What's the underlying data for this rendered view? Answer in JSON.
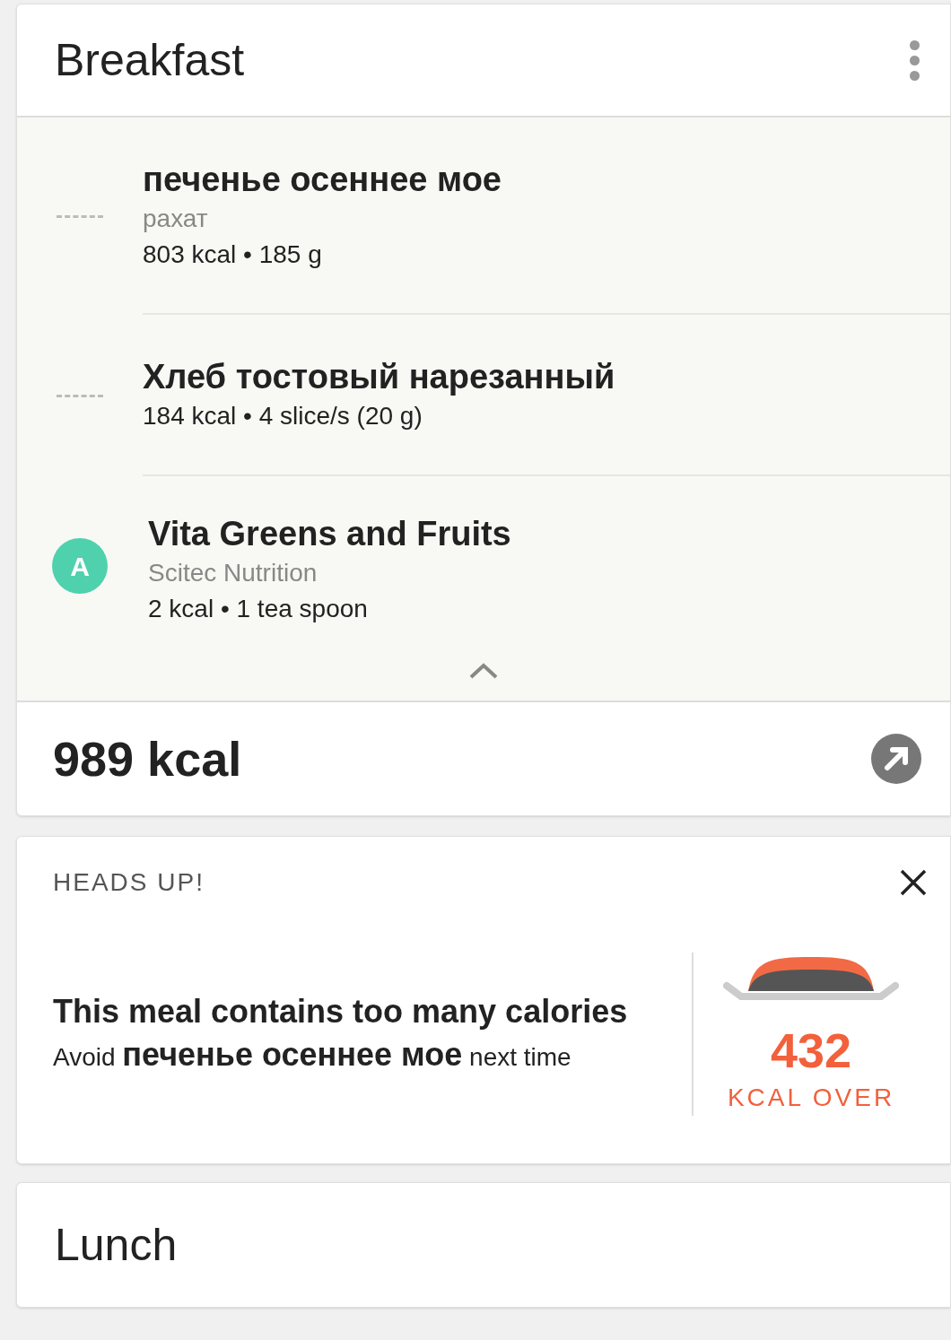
{
  "meal": {
    "title": "Breakfast",
    "items": [
      {
        "kind": "dashes",
        "name": "печенье осеннее мое",
        "brand": "рахат",
        "detail": "803 kcal • 185 g"
      },
      {
        "kind": "dashes",
        "name": "Хлеб тостовый нарезанный",
        "detail": "184 kcal • 4 slice/s (20 g)"
      },
      {
        "kind": "avatar",
        "avatar": "A",
        "name": "Vita Greens and Fruits",
        "brand": "Scitec Nutrition",
        "detail": "2 kcal • 1 tea spoon"
      }
    ],
    "expanded": true,
    "total": "989 kcal"
  },
  "alert": {
    "title": "HEADS UP!",
    "headline": "This meal contains too many calories",
    "message": "Avoid **печенье осеннее мое** next time",
    "value": "432",
    "unit": "KCAL OVER"
  },
  "next_meal": {
    "title": "Lunch"
  }
}
